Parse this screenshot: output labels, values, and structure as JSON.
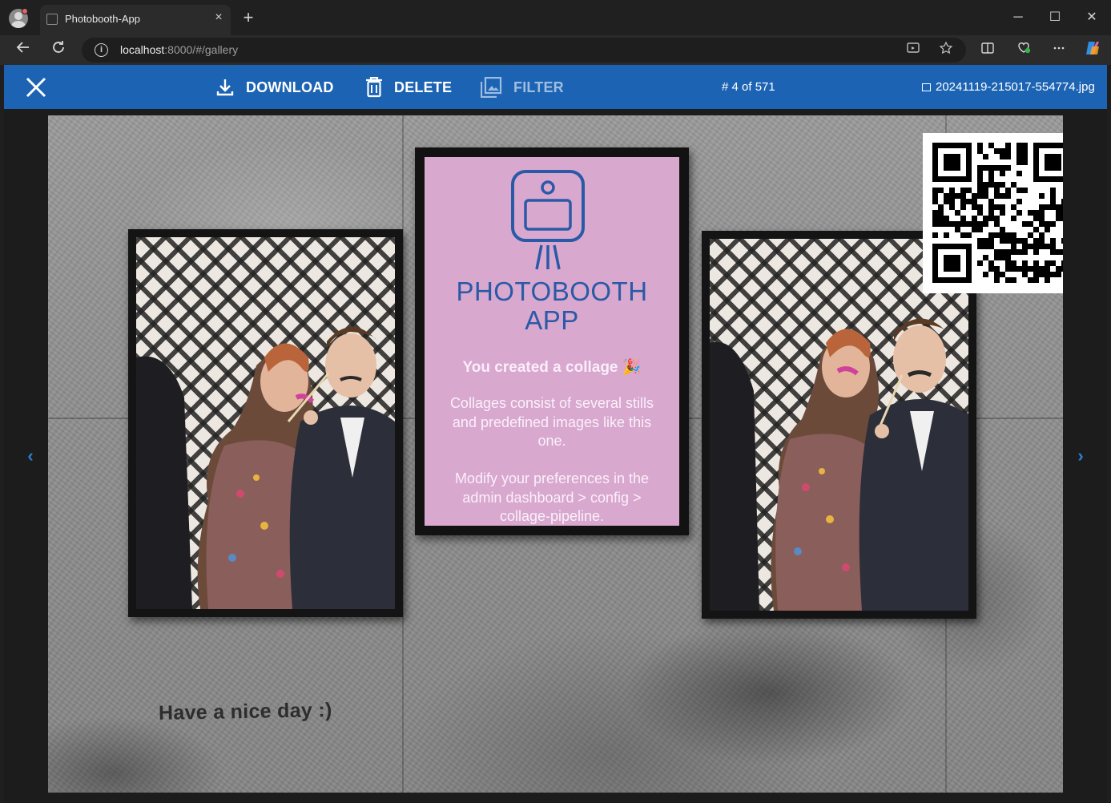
{
  "browser": {
    "tab_title": "Photobooth-App",
    "tab_close": "×",
    "new_tab": "+",
    "url_host": "localhost",
    "url_rest": ":8000/#/gallery",
    "window_controls": [
      "─",
      "☐",
      "✕"
    ]
  },
  "header": {
    "download_label": "DOWNLOAD",
    "delete_label": "DELETE",
    "filter_label": "FILTER",
    "counter": "# 4 of 571",
    "filename": "20241119-215017-554774.jpg"
  },
  "photo": {
    "poster_title_line1": "PHOTOBOOTH",
    "poster_title_line2": "APP",
    "poster_subtitle": "You created a collage 🎉",
    "poster_text_1_line1": "Collages consist of several stills",
    "poster_text_1_line2": "and predefined images like this",
    "poster_text_1_line3": "one.",
    "poster_text_2_line1": "Modify your preferences in the",
    "poster_text_2_line2": "admin dashboard > config >",
    "poster_text_2_line3": "collage-pipeline.",
    "caption": "Have a nice day :)"
  },
  "nav": {
    "prev": "‹",
    "next": "›"
  },
  "colors": {
    "header_bg": "#1c64b3",
    "poster_bg": "#d8a8cf",
    "poster_accent": "#2a5aa6",
    "nav_arrow": "#2b7fd8"
  }
}
